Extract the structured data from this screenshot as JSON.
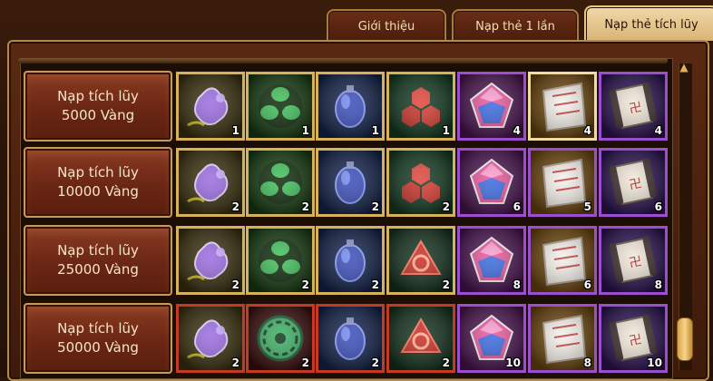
{
  "tabs": [
    {
      "label": "Giới thiệu",
      "active": false
    },
    {
      "label": "Nạp thẻ 1 lần",
      "active": false
    },
    {
      "label": "Nạp thẻ tích lũy",
      "active": true
    }
  ],
  "rows": [
    {
      "line1": "Nạp tích lũy",
      "line2": "5000 Vàng",
      "items": [
        {
          "icon": "purple-puzzle-stone-icon",
          "qty": "1",
          "frame": "gold"
        },
        {
          "icon": "green-triskelion-icon",
          "qty": "1",
          "frame": "gold"
        },
        {
          "icon": "blue-egg-gem-icon",
          "qty": "1",
          "frame": "gold"
        },
        {
          "icon": "red-hexagon-cluster-icon",
          "qty": "1",
          "frame": "gold"
        },
        {
          "icon": "pink-blue-diamond-icon",
          "qty": "4",
          "frame": "purple"
        },
        {
          "icon": "scroll-ticket-icon",
          "qty": "4",
          "frame": "gold-lt"
        },
        {
          "icon": "rolled-scroll-icon",
          "qty": "4",
          "frame": "purple"
        }
      ]
    },
    {
      "line1": "Nạp tích lũy",
      "line2": "10000 Vàng",
      "items": [
        {
          "icon": "purple-puzzle-stone-icon",
          "qty": "2",
          "frame": "gold"
        },
        {
          "icon": "green-triskelion-icon",
          "qty": "2",
          "frame": "gold"
        },
        {
          "icon": "blue-egg-gem-icon",
          "qty": "2",
          "frame": "gold"
        },
        {
          "icon": "red-hexagon-cluster-icon",
          "qty": "2",
          "frame": "gold"
        },
        {
          "icon": "pink-blue-diamond-icon",
          "qty": "6",
          "frame": "purple"
        },
        {
          "icon": "scroll-ticket-icon",
          "qty": "5",
          "frame": "purple"
        },
        {
          "icon": "rolled-scroll-icon",
          "qty": "6",
          "frame": "purple"
        }
      ]
    },
    {
      "line1": "Nạp tích lũy",
      "line2": "25000 Vàng",
      "items": [
        {
          "icon": "purple-puzzle-stone-icon",
          "qty": "2",
          "frame": "gold"
        },
        {
          "icon": "green-triskelion-icon",
          "qty": "2",
          "frame": "gold"
        },
        {
          "icon": "blue-egg-gem-icon",
          "qty": "2",
          "frame": "gold"
        },
        {
          "icon": "red-triquetra-icon",
          "qty": "2",
          "frame": "gold"
        },
        {
          "icon": "pink-blue-diamond-icon",
          "qty": "8",
          "frame": "purple"
        },
        {
          "icon": "scroll-ticket-icon",
          "qty": "6",
          "frame": "purple"
        },
        {
          "icon": "rolled-scroll-icon",
          "qty": "8",
          "frame": "purple"
        }
      ]
    },
    {
      "line1": "Nạp tích lũy",
      "line2": "50000 Vàng",
      "items": [
        {
          "icon": "purple-puzzle-stone-icon",
          "qty": "2",
          "frame": "red"
        },
        {
          "icon": "green-flower-icon",
          "qty": "2",
          "frame": "red"
        },
        {
          "icon": "blue-egg-gem-icon",
          "qty": "2",
          "frame": "red"
        },
        {
          "icon": "red-triquetra-icon",
          "qty": "2",
          "frame": "red"
        },
        {
          "icon": "pink-blue-diamond-icon",
          "qty": "10",
          "frame": "purple"
        },
        {
          "icon": "scroll-ticket-icon",
          "qty": "8",
          "frame": "purple"
        },
        {
          "icon": "rolled-scroll-icon",
          "qty": "10",
          "frame": "purple"
        }
      ]
    }
  ]
}
